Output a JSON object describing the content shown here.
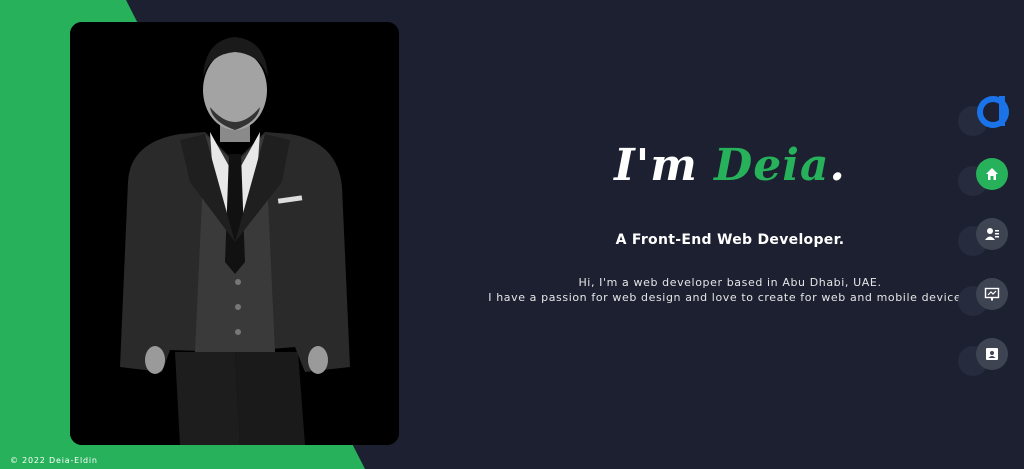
{
  "hero": {
    "greeting": "I'm",
    "name": "Deia",
    "period": ".",
    "subtitle": "A Front-End Web Developer.",
    "intro_line1": "Hi, I'm a web developer based in Abu Dhabi, UAE.",
    "intro_line2": "I have a passion for web design and love to create for web and mobile devices."
  },
  "footer": {
    "copyright": "© 2022 Deia-Eldin"
  },
  "colors": {
    "background": "#1c2031",
    "accent": "#26b15a",
    "nav_button": "#3f4453"
  },
  "nav": [
    {
      "icon": "home-icon",
      "active": true
    },
    {
      "icon": "about-icon",
      "active": false
    },
    {
      "icon": "portfolio-icon",
      "active": false
    },
    {
      "icon": "contact-icon",
      "active": false
    }
  ]
}
